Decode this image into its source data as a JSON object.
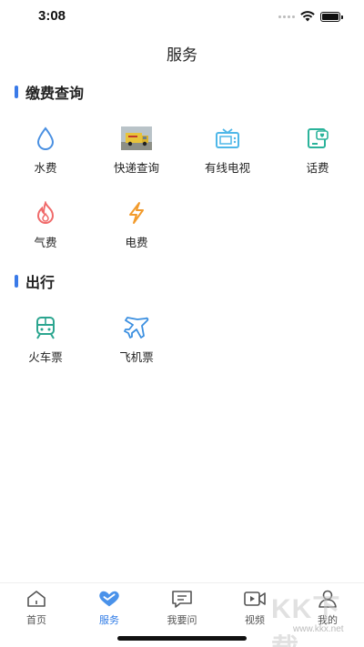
{
  "status": {
    "time": "3:08"
  },
  "page": {
    "title": "服务"
  },
  "sections": [
    {
      "title": "缴费查询",
      "items": [
        {
          "label": "水费",
          "icon": "water-drop-icon"
        },
        {
          "label": "快递查询",
          "icon": "delivery-truck-photo"
        },
        {
          "label": "有线电视",
          "icon": "tv-icon"
        },
        {
          "label": "话费",
          "icon": "phone-bill-icon"
        },
        {
          "label": "气费",
          "icon": "flame-icon"
        },
        {
          "label": "电费",
          "icon": "lightning-icon"
        }
      ]
    },
    {
      "title": "出行",
      "items": [
        {
          "label": "火车票",
          "icon": "train-icon"
        },
        {
          "label": "飞机票",
          "icon": "airplane-icon"
        }
      ]
    }
  ],
  "tabs": [
    {
      "label": "首页",
      "icon": "home-icon",
      "active": false
    },
    {
      "label": "服务",
      "icon": "heart-icon",
      "active": true
    },
    {
      "label": "我要问",
      "icon": "chat-icon",
      "active": false
    },
    {
      "label": "视频",
      "icon": "video-icon",
      "active": false
    },
    {
      "label": "我的",
      "icon": "user-icon",
      "active": false
    }
  ],
  "colors": {
    "accent": "#2f7be6",
    "water": "#4a90e2",
    "tv": "#4fb7e8",
    "phone": "#2bb39b",
    "flame": "#f06a6a",
    "lightning": "#f29b2c",
    "train": "#2ba58f",
    "plane": "#3b8fe0"
  },
  "watermark": {
    "main": "KK下载",
    "sub": "www.kkx.net"
  }
}
